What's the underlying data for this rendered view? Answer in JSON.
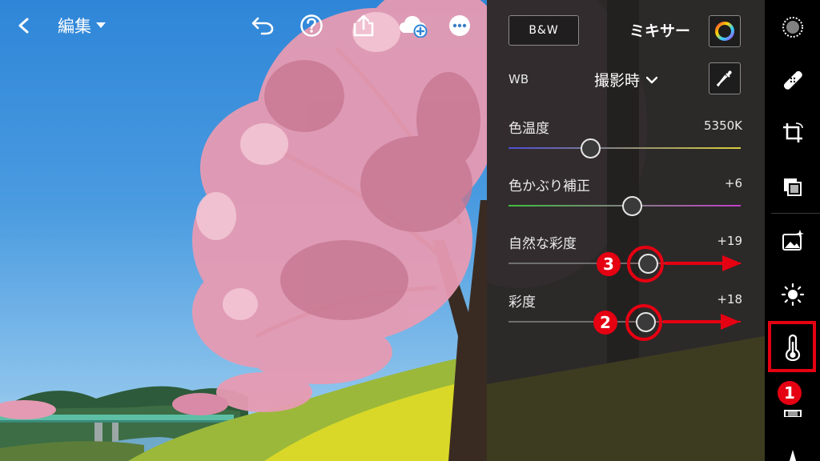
{
  "toolbar": {
    "edit_label": "編集",
    "icons": [
      "back-icon",
      "caret-down-icon",
      "undo-icon",
      "help-icon",
      "share-icon",
      "cloud-add-icon",
      "more-icon"
    ]
  },
  "panel": {
    "bw_label": "B&W",
    "mixer_label": "ミキサー",
    "wb_label": "WB",
    "wb_value": "撮影時",
    "sliders": [
      {
        "label": "色温度",
        "value": "5350K",
        "position": 0.35
      },
      {
        "label": "色かぶり補正",
        "value": "+6",
        "position": 0.53
      },
      {
        "label": "自然な彩度",
        "value": "+19",
        "position": 0.6
      },
      {
        "label": "彩度",
        "value": "+18",
        "position": 0.59
      }
    ]
  },
  "annotations": {
    "badge_1": "1",
    "badge_2": "2",
    "badge_3": "3",
    "color": "#e50012"
  },
  "rail": {
    "icons": [
      "selective-icon",
      "healing-icon",
      "crop-icon",
      "versions-icon",
      "presets-icon",
      "light-icon",
      "color-icon",
      "effects-icon",
      "more-tools-icon"
    ]
  },
  "colors": {
    "temp_start": "#4e4ed8",
    "temp_end": "#d8cf3a",
    "tint_start": "#3fbf3f",
    "tint_end": "#c040c8",
    "accent": "#e50012"
  }
}
